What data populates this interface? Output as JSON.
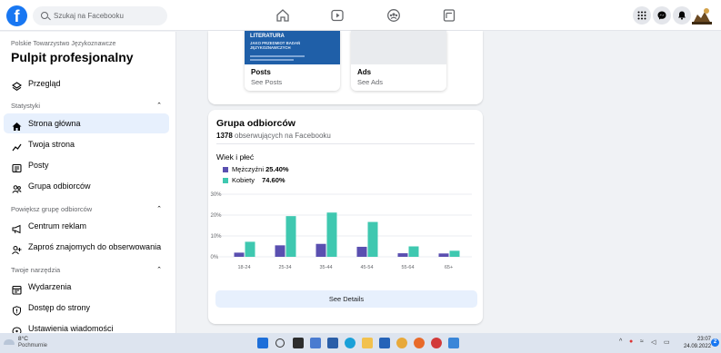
{
  "topbar": {
    "logo_letter": "f",
    "search_placeholder": "Szukaj na Facebooku",
    "nav_icons": [
      "home-icon",
      "watch-icon",
      "groups-icon",
      "pages-icon"
    ],
    "right_icons": [
      "menu-grid-icon",
      "messenger-icon",
      "notifications-icon",
      "profile-avatar"
    ]
  },
  "sidebar": {
    "org_name": "Polskie Towarzystwo Językoznawcze",
    "title": "Pulpit profesjonalny",
    "overview": "Przegląd",
    "section_stats": "Statystyki",
    "stats_items": [
      {
        "label": "Strona główna",
        "icon": "home-icon"
      },
      {
        "label": "Twoja strona",
        "icon": "trend-icon"
      },
      {
        "label": "Posty",
        "icon": "posts-icon"
      },
      {
        "label": "Grupa odbiorców",
        "icon": "audience-icon"
      }
    ],
    "section_grow": "Powiększ grupę odbiorców",
    "grow_items": [
      {
        "label": "Centrum reklam",
        "icon": "megaphone-icon"
      },
      {
        "label": "Zaproś znajomych do obserwowania",
        "icon": "invite-icon"
      }
    ],
    "section_tools": "Twoje narzędzia",
    "tools_items": [
      {
        "label": "Wydarzenia",
        "icon": "calendar-icon"
      },
      {
        "label": "Dostęp do strony",
        "icon": "shield-icon"
      },
      {
        "label": "Ustawienia wiadomości",
        "icon": "chat-settings-icon"
      }
    ]
  },
  "top_card": {
    "posts": {
      "label": "Posts",
      "sub": "See Posts"
    },
    "ads": {
      "label": "Ads",
      "sub": "See Ads"
    },
    "thumb_title": "LITERATURA",
    "thumb_subtitle": "JAKO PRZEDMIOT BADAŃ JĘZYKOZNAWCZYCH"
  },
  "audience": {
    "title": "Grupa odbiorców",
    "followers_count": "1378",
    "followers_text": "obserwujących na Facebooku",
    "age_gender_label": "Wiek i płeć",
    "legend": [
      {
        "name": "Mężczyźni",
        "value": "25.40%",
        "color": "#5a4fb0"
      },
      {
        "name": "Kobiety",
        "value": "74.60%",
        "color": "#3fc8b0"
      }
    ],
    "see_details": "See Details"
  },
  "chart_data": {
    "type": "bar",
    "categories": [
      "18-24",
      "25-34",
      "35-44",
      "45-54",
      "55-64",
      "65+"
    ],
    "series": [
      {
        "name": "Mężczyźni",
        "values": [
          2,
          5.5,
          6.2,
          4.8,
          1.7,
          1.6
        ]
      },
      {
        "name": "Kobiety",
        "values": [
          7.2,
          19.5,
          21.2,
          16.7,
          5,
          2.9
        ]
      }
    ],
    "yticks": [
      "30%",
      "20%",
      "10%",
      "0%"
    ],
    "ylim": [
      0,
      30
    ],
    "grid": true,
    "legend": "top-left"
  },
  "taskbar": {
    "weather_temp": "8°C",
    "weather_desc": "Pochmurnie",
    "time": "23:07",
    "date": "24.09.2022",
    "notification_count": "2"
  },
  "colors": {
    "brand": "#1877f2",
    "male": "#5a4fb0",
    "female": "#3fc8b0",
    "active_bg": "#e7f0fd"
  }
}
